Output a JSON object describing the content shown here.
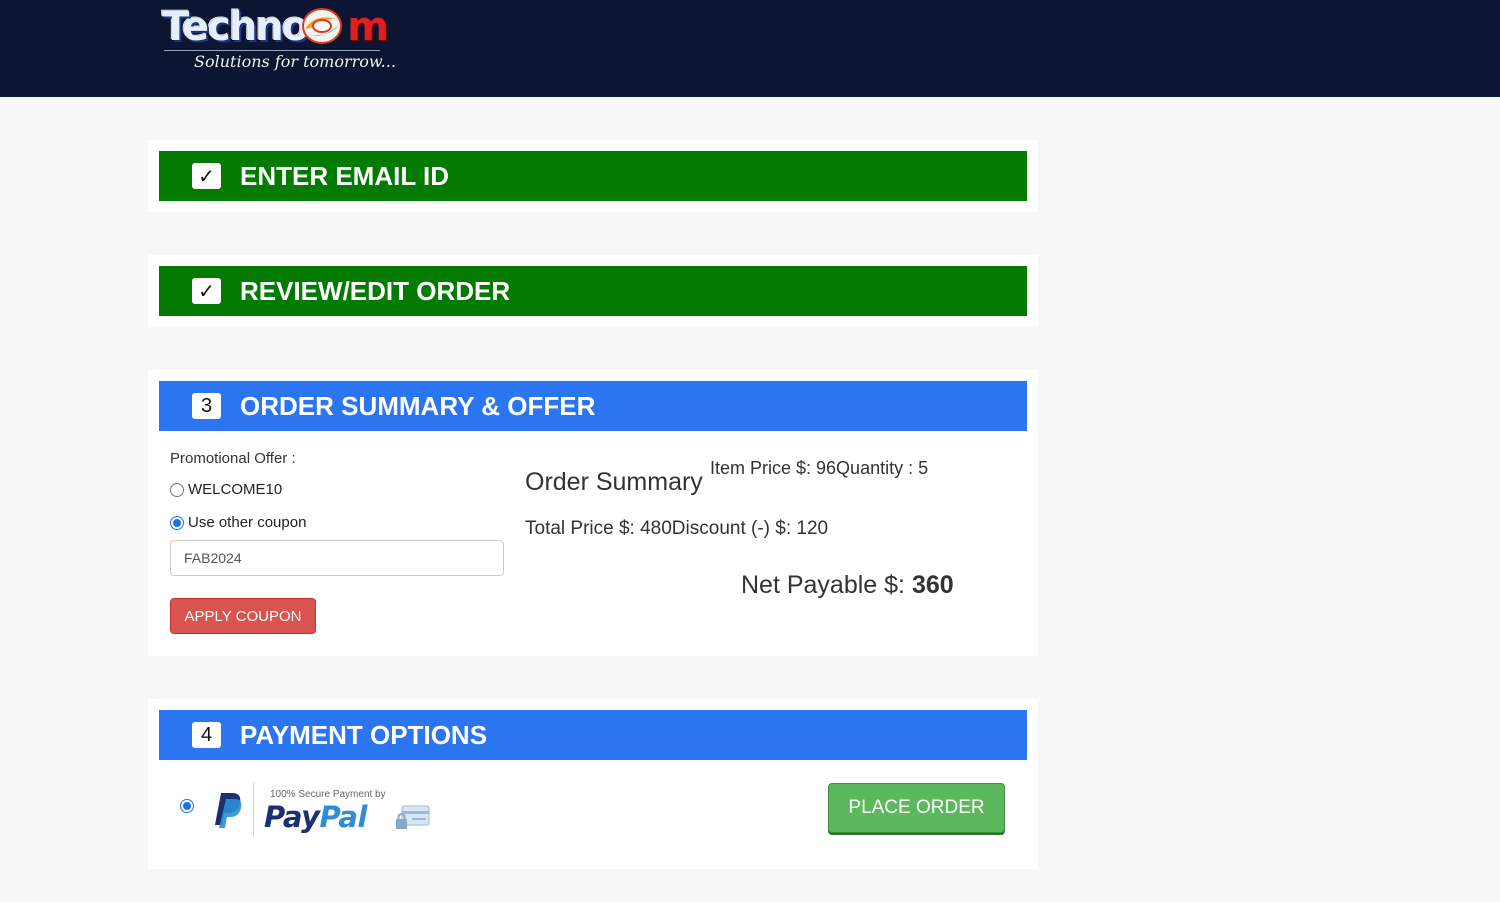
{
  "brand": {
    "logo_text_part1": "Techno",
    "logo_text_part2": "m",
    "tagline": "Solutions for tomorrow..."
  },
  "steps": [
    {
      "badge": "✓",
      "title": "ENTER EMAIL ID",
      "status": "complete",
      "color": "#037b00"
    },
    {
      "badge": "✓",
      "title": "REVIEW/EDIT ORDER",
      "status": "complete",
      "color": "#037b00"
    },
    {
      "badge": "3",
      "title": "ORDER SUMMARY & OFFER",
      "status": "active",
      "color": "#2b75f0"
    },
    {
      "badge": "4",
      "title": "PAYMENT OPTIONS",
      "status": "active",
      "color": "#2b75f0"
    }
  ],
  "offer": {
    "label": "Promotional Offer :",
    "options": [
      {
        "label": "WELCOME10",
        "selected": false
      },
      {
        "label": "Use other coupon",
        "selected": true
      }
    ],
    "coupon_value": "FAB2024",
    "apply_label": "APPLY COUPON"
  },
  "summary": {
    "heading": "Order Summary",
    "item_line": "Item Price $: 96Quantity : 5",
    "total_line": "Total Price $: 480Discount (-) $: 120",
    "net_label": "Net Payable $: ",
    "net_value": "360"
  },
  "payment": {
    "provider_icon": "paypal-icon",
    "secure_text": "100% Secure Payment by",
    "word_pay": "Pay",
    "word_pal": "Pal",
    "selected": true,
    "place_order_label": "PLACE ORDER"
  }
}
